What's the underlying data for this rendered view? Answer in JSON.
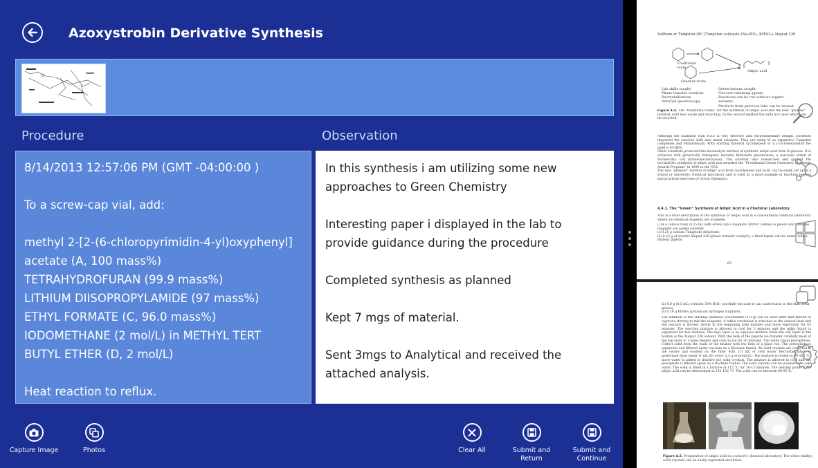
{
  "header": {
    "title": "Azoxystrobin Derivative Synthesis"
  },
  "sections": {
    "procedure_heading": "Procedure",
    "observation_heading": "Observation"
  },
  "procedure": {
    "timestamp": "8/14/2013 12:57:06 PM (GMT -04:00:00 )",
    "intro": "To a screw-cap vial, add:",
    "reagent_1": "methyl 2-[2-(6-chloropyrimidin-4-yl)oxyphenyl]",
    "reagent_1_cont": "acetate (A, 100 mass%)",
    "reagent_2": "TETRAHYDROFURAN (99.9 mass%)",
    "reagent_3": "LITHIUM DIISOPROPYLAMIDE (97 mass%)",
    "reagent_4": "ETHYL FORMATE (C, 96.0 mass%)",
    "reagent_5": "IODOMETHANE (2 mol/L) in METHYL TERT",
    "reagent_5_cont": "BUTYL ETHER (D, 2 mol/L)",
    "step_2": "Heat reaction to reflux."
  },
  "observation": {
    "p1": "In this synthesis i am utilizing some new approaches to Green Chemistry",
    "p2": "Interesting paper i displayed in the lab to provide guidance during the procedure",
    "p3": "Completed synthesis as planned",
    "p4": "Kept 7 mgs of material.",
    "p5": "Sent 3mgs to Analytical and received the attached analysis."
  },
  "appbar": {
    "capture_label": "Capture Image",
    "photos_label": "Photos",
    "clear_label": "Clear All",
    "submit_return_label_1": "Submit and",
    "submit_return_label_2": "Return",
    "submit_continue_label_1": "Submit and",
    "submit_continue_label_2": "Continue"
  },
  "document": {
    "page1_heading": "Vallham or Tungsten (W) (Tungsten catalysts (Na₂WO₄, KHSO₄) Aliquat 336",
    "scheme_traditional": "Traditional route",
    "scheme_greener": "Greener route",
    "scheme_product": "Adipic acid",
    "lab_skills_heading": "Lab skills taught",
    "lab_skills_text": "Phase transfer catalysis\nRecrystallization\nInfrared spectroscopy",
    "green_lessons_heading": "Green lessons taught",
    "green_lessons_text": "Uncover oxidizing agents\nReactions can be run without organic solvents\nProducts from previous labs can be reused",
    "figure_4_4_label": "Figure 4.4.",
    "figure_4_4_caption": "The “traditional route” for the synthesis of adipic acid and the new “greener” method, with less waste and recycling. In the second method the salts are used which can be recycled.",
    "page1_para1": "Although the oxidation with H₂O₂ is very effective and environmentally benign, scientists improved the reaction with new metal catalysts. They are using W as oxpeneroo Tungsten complexes and Molybdenum. With starting material cyclohexene or 1,2-cyclohexanediol the yield is 45-66%.",
    "page1_para2": "Other scientists promoted the biocatalytic method of synthetic adipic acid from D-glucose. It is achieved with genetically transgenic bacteria Klebsiella pneumoniae, a non-toxic strain of Escherichia coli (Enterobacteriaceae). The scientist who researched and applied the biocatalytic synthesis of adipic acid was awarded the “Presidential Green Chemistry Challenge Awards Program” in 1998 in the USA.",
    "page1_para3": "The new “greener” method of adipic acid from cyclohexene and H₂O₂ can be easily set up in a school or university chemical laboratory and is used as a good example in teaching lessons and practical exercises of Green Chemistry.",
    "section_4_4_1": "4.4.1. The “Green” Synthesis of Adipic Acid in a Chemical Laboratory",
    "page1_para4": "This is a brief description of the synthesis of Adipic acid in a conventional chemical laboratory where all chemical reagents are available.",
    "page1_list": "i) In a conical flask of 25 mL with screw cap a magnetic stirrer (Teflon) is placed and then the reagents are added carefully\nii) 0.25 g sodium Tungstate dehydrate,\niii) 0.25 g of solvent Aliquat 336 (phase transfer catalyst), a thick liquid, can be added with a Pasteur pipette,",
    "page1_number": "60",
    "page2_list": "iii) 8.0 g (8.5 mL) solution 30% H₂O₂ (carefully because it can cause burns to the skin, wear gloves),\niv) 0.19 g KHSO₄ (potassium hydrogen sulphate).",
    "page2_para": "The addition of the starting chemical cyclohexene (1.0 g) can be done after half minute of vigorous stirring to mix the reagents. A reflux condenser is attached to the conical flask and the mixture is stirred, slowly in the beginning (one minute) and more vigorously for 45 minutes. The reaction mixture is allowed to cool for 3 minutes and the milky liquid is separated for few minutes. The tops layer is an aqueous mixture while the oily layer at the bottom is the Aliquat 336 solvent. With the help of the pipette we transfer carefully most of the top layer to a glass beaker and cool on ice for 30 minutes. The white liquid precipitates. Collect solid from the walls of the beaker with the help of a glass rod. The precipitate is separated and filtered under vacuum on a Buchner funnel. All solid crystals are collected in the centre and washed on the filter with 2-3 mL of cold water. Recrystallization is performed from water (1 mL for every 2.3 g of product). The mixture is boiled to 80-105 °C, more water is added to dissolve the solid crystals. The mixture is allowed to cool and the precipitate is filtered again on a Buchner funnel. The solid crystals can be washed with cold water. The solid is dried in a furnace at 115 °C for 10-15 minutes. The melting point of the adipic acid can be determined at 151-152 °C. The yield can be between 80-95 %.",
    "figure_4_5_label": "Figure 4.5.",
    "figure_4_5_caption": "Preparation of adipic acid in a school's chemical laboratory. The white (milky) solid crystals can be easily separated and dried."
  },
  "colors": {
    "app_background": "#1b2f94",
    "accent_panel": "#5b87da",
    "image_strip": "#5b8ce0",
    "splitter": "#000000"
  },
  "icons": [
    "back-arrow-icon",
    "camera-icon",
    "photos-icon",
    "clear-icon",
    "save-icon",
    "zoom-icon",
    "share-icon",
    "start-icon",
    "devices-icon",
    "settings-icon"
  ]
}
